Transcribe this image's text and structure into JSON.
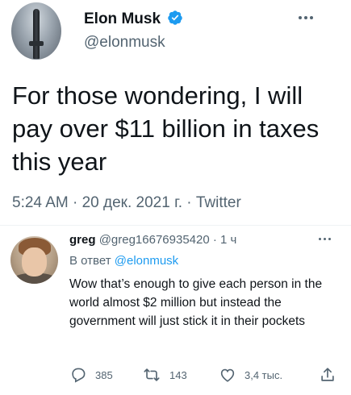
{
  "tweet": {
    "author_name": "Elon Musk",
    "author_handle": "@elonmusk",
    "text": "For those wondering, I will pay over $11 billion in taxes this year",
    "meta": "5:24 AM · 20 дек. 2021 г. · Twitter"
  },
  "reply": {
    "author_name": "greg",
    "author_handle": "@greg16676935420",
    "time": "· 1 ч",
    "in_reply_to_label": "В ответ",
    "in_reply_to_handle": "@elonmusk",
    "text": "Wow that’s enough to give each person in the world almost $2 million but instead the government will just stick it in their pockets",
    "actions": {
      "reply_count": "385",
      "retweet_count": "143",
      "like_count": "3,4 тыс."
    }
  },
  "icons": [
    "verified-badge-icon",
    "more-options-icon",
    "reply-icon",
    "retweet-icon",
    "like-icon",
    "share-icon"
  ],
  "colors": {
    "accent": "#1d9bf0",
    "secondary_text": "#536471",
    "primary_text": "#0f1419"
  }
}
